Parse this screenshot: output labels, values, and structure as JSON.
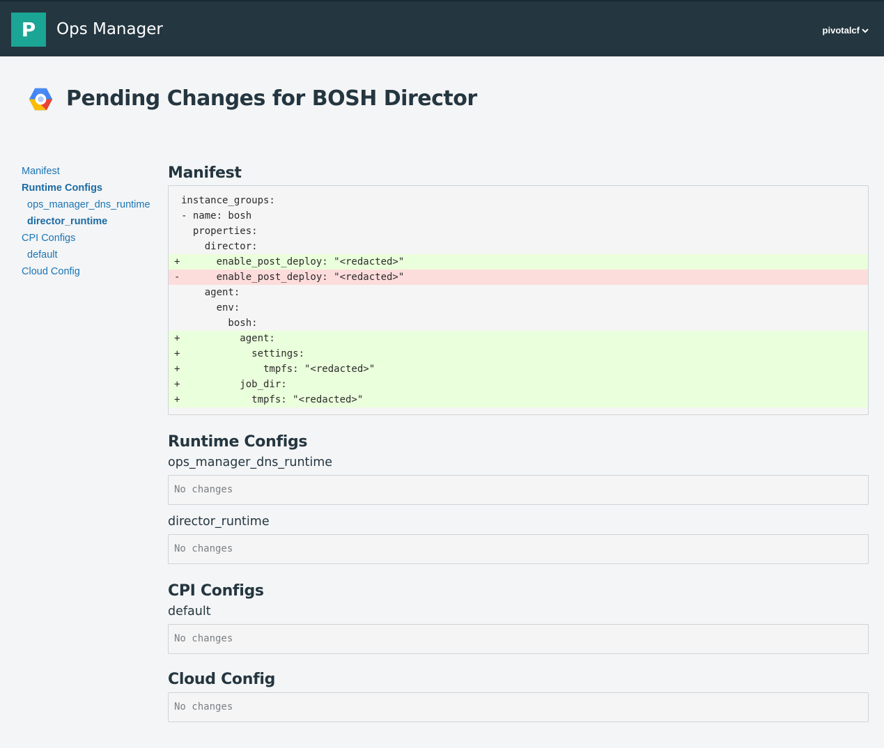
{
  "header": {
    "logo_letter": "P",
    "app_title": "Ops Manager",
    "user": "pivotalcf"
  },
  "page": {
    "title": "Pending Changes for BOSH Director"
  },
  "sidebar": {
    "items": [
      {
        "label": "Manifest",
        "level": 0,
        "active": false
      },
      {
        "label": "Runtime Configs",
        "level": 0,
        "active": true
      },
      {
        "label": "ops_manager_dns_runtime",
        "level": 1,
        "active": false
      },
      {
        "label": "director_runtime",
        "level": 1,
        "active": true
      },
      {
        "label": "CPI Configs",
        "level": 0,
        "active": false
      },
      {
        "label": "default",
        "level": 1,
        "active": false
      },
      {
        "label": "Cloud Config",
        "level": 0,
        "active": false
      }
    ]
  },
  "manifest": {
    "heading": "Manifest",
    "lines": [
      {
        "type": "ctx",
        "text": "instance_groups:"
      },
      {
        "type": "ctx",
        "text": "- name: bosh"
      },
      {
        "type": "ctx",
        "text": "  properties:"
      },
      {
        "type": "ctx",
        "text": "    director:"
      },
      {
        "type": "add",
        "text": "      enable_post_deploy: \"<redacted>\""
      },
      {
        "type": "del",
        "text": "      enable_post_deploy: \"<redacted>\""
      },
      {
        "type": "ctx",
        "text": "    agent:"
      },
      {
        "type": "ctx",
        "text": "      env:"
      },
      {
        "type": "ctx",
        "text": "        bosh:"
      },
      {
        "type": "add",
        "text": "          agent:"
      },
      {
        "type": "add",
        "text": "            settings:"
      },
      {
        "type": "add",
        "text": "              tmpfs: \"<redacted>\""
      },
      {
        "type": "add",
        "text": "          job_dir:"
      },
      {
        "type": "add",
        "text": "            tmpfs: \"<redacted>\""
      }
    ],
    "markers": {
      "add": "+",
      "del": "-",
      "ctx": ""
    }
  },
  "runtime_configs": {
    "heading": "Runtime Configs",
    "items": [
      {
        "name": "ops_manager_dns_runtime",
        "status": "No changes"
      },
      {
        "name": "director_runtime",
        "status": "No changes"
      }
    ]
  },
  "cpi_configs": {
    "heading": "CPI Configs",
    "items": [
      {
        "name": "default",
        "status": "No changes"
      }
    ]
  },
  "cloud_config": {
    "heading": "Cloud Config",
    "status": "No changes"
  },
  "colors": {
    "header_bg": "#243640",
    "logo_bg": "#1aa595",
    "link": "#1a75b5",
    "diff_add_bg": "#eaffdb",
    "diff_del_bg": "#fddcdc"
  },
  "icons": {
    "user_menu": "chevron-down-icon",
    "tile": "google-cloud-hexagon-icon"
  }
}
